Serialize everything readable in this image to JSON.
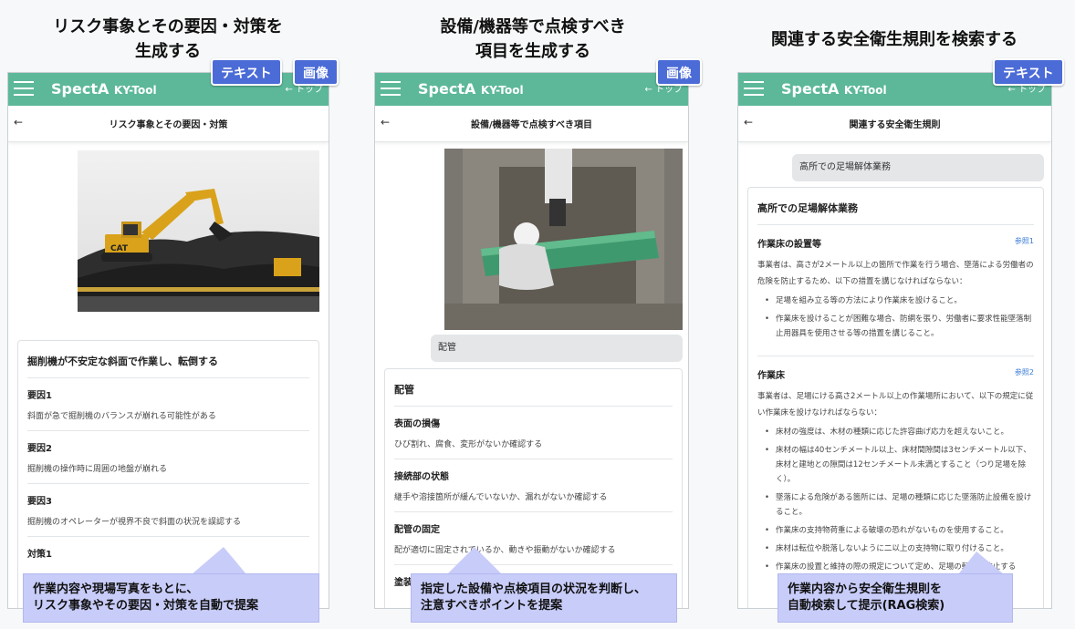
{
  "columns": [
    {
      "heading_line1": "リスク事象とその要因・対策を",
      "heading_line2": "生成する",
      "app": {
        "brand": "SpectA",
        "brand_sub": "KY-Tool",
        "nav": "← トップ",
        "back": "←",
        "page_title": "リスク事象とその要因・対策"
      },
      "tags": [
        "テキスト",
        "画像"
      ],
      "card_title": "掘削機が不安定な斜面で作業し、転倒する",
      "items": [
        {
          "head": "要因1",
          "text": "斜面が急で掘削機のバランスが崩れる可能性がある"
        },
        {
          "head": "要因2",
          "text": "掘削機の操作時に周囲の地盤が崩れる"
        },
        {
          "head": "要因3",
          "text": "掘削機のオペレーターが視界不良で斜面の状況を誤認する"
        },
        {
          "head": "対策1",
          "text": ""
        }
      ],
      "callout_line1": "作業内容や現場写真をもとに、",
      "callout_line2": "リスク事象やその要因・対策を自動で提案"
    },
    {
      "heading_line1": "設備/機器等で点検すべき",
      "heading_line2": "項目を生成する",
      "app": {
        "brand": "SpectA",
        "brand_sub": "KY-Tool",
        "nav": "← トップ",
        "back": "←",
        "page_title": "設備/機器等で点検すべき項目"
      },
      "tags": [
        "画像"
      ],
      "bubble": "配管",
      "card_title": "配管",
      "items": [
        {
          "head": "表面の損傷",
          "text": "ひび割れ、腐食、変形がないか確認する"
        },
        {
          "head": "接続部の状態",
          "text": "継手や溶接箇所が緩んでいないか、漏れがないか確認する"
        },
        {
          "head": "配管の固定",
          "text": "配が適切に固定されているか、動きや振動がないか確認する"
        },
        {
          "head": "塗装",
          "text": ""
        }
      ],
      "callout_line1": "指定した設備や点検項目の状況を判断し、",
      "callout_line2": "注意すべきポイントを提案"
    },
    {
      "heading_line1": "関連する安全衛生規則を検索する",
      "app": {
        "brand": "SpectA",
        "brand_sub": "KY-Tool",
        "nav": "← トップ",
        "back": "←",
        "page_title": "関連する安全衛生規則"
      },
      "tags": [
        "テキスト"
      ],
      "bubble": "高所での足場解体業務",
      "card_title": "高所での足場解体業務",
      "rules": [
        {
          "head": "作業床の設置等",
          "ref": "参照1",
          "text": "事業者は、高さが2メートル以上の箇所で作業を行う場合、墜落による労働者の危険を防止するため、以下の措置を講じなければならない：",
          "bullets": [
            "足場を組み立る等の方法により作業床を設けること。",
            "作業床を設けることが困難な場合、防網を張り、労働者に要求性能墜落制止用器具を使用させる等の措置を講じること。"
          ]
        },
        {
          "head": "作業床",
          "ref": "参照2",
          "text": "事業者は、足場にける高さ2メートル以上の作業場所において、以下の規定に従い作業床を設けなければならない：",
          "bullets": [
            "床材の強度は、木材の種類に応じた許容曲げ応力を超えないこと。",
            "床材の幅は40センチメートル以上、床材間隙間は3センチメートル以下、床材と建地との隙間は12センチメートル未満とすること（つり足場を除く）。",
            "墜落による危険がある箇所には、足場の種類に応じた墜落防止設備を設けること。",
            "作業床の支持物荷重による破壊の恐れがないものを使用すること。",
            "床材は転位や脱落しないように二以上の支持物に取り付けること。",
            "作業床の設置と維持の際の規定について定め、足場の転落を防止する"
          ]
        }
      ],
      "callout_line1": "作業内容から安全衛生規則を",
      "callout_line2": "自動検索して提示(RAG検索)"
    }
  ]
}
